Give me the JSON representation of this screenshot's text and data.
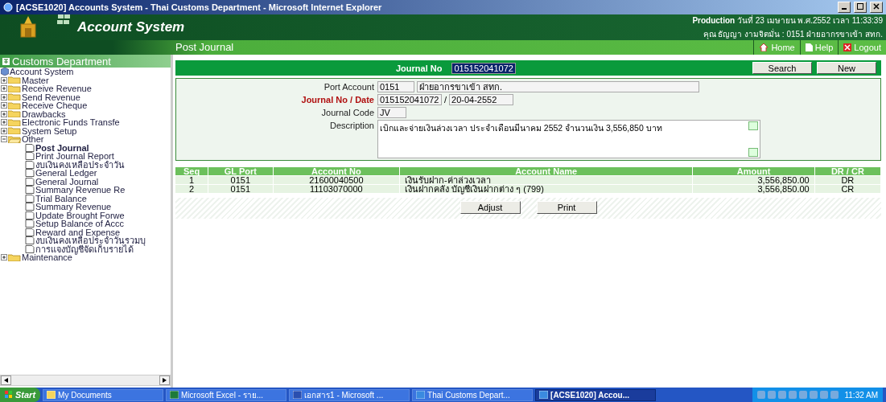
{
  "window": {
    "title": "[ACSE1020] Accounts System - Thai Customs Department - Microsoft Internet Explorer"
  },
  "header": {
    "app_name": "Account System",
    "environment": "Production",
    "datetime": "วันที่ 23 เมษายน พ.ศ.2552 เวลา 11:33:39",
    "user": "คุณ ธัญญา งามจิตมั่น : 0151 ฝ่ายอากรขาเข้า สทก.",
    "page_title": "Post Journal",
    "links": [
      {
        "kind": "home",
        "label": "Home"
      },
      {
        "kind": "help",
        "label": "Help"
      },
      {
        "kind": "logout",
        "label": "Logout"
      }
    ]
  },
  "sidebar": {
    "title": "Customs Department",
    "root": "Account System",
    "items": [
      {
        "label": "Master",
        "expanded": false
      },
      {
        "label": "Receive Revenue",
        "expanded": false
      },
      {
        "label": "Send Revenue",
        "expanded": false
      },
      {
        "label": "Receive Cheque",
        "expanded": false
      },
      {
        "label": "Drawbacks",
        "expanded": false
      },
      {
        "label": "Electronic Funds Transfe",
        "expanded": false
      },
      {
        "label": "System Setup",
        "expanded": false
      },
      {
        "label": "Other",
        "expanded": true,
        "children": [
          {
            "label": "Post Journal",
            "selected": true
          },
          {
            "label": "Print Journal Report",
            "selected": false
          },
          {
            "label": "งบเงินคงเหลือประจำวัน",
            "selected": false
          },
          {
            "label": "General Ledger",
            "selected": false
          },
          {
            "label": "General Journal",
            "selected": false
          },
          {
            "label": "Summary Revenue Re",
            "selected": false
          },
          {
            "label": "Trial Balance",
            "selected": false
          },
          {
            "label": "Summary Revenue",
            "selected": false
          },
          {
            "label": "Update Brought Forwe",
            "selected": false
          },
          {
            "label": "Setup Balance of Accc",
            "selected": false
          },
          {
            "label": "Reward and Expense",
            "selected": false
          },
          {
            "label": "งบเงินคงเหลือประจำวันรวมบุ",
            "selected": false
          },
          {
            "label": "การแจงบัญชีจัดเก็บรายได้",
            "selected": false
          }
        ]
      },
      {
        "label": "Maintenance",
        "expanded": false
      }
    ]
  },
  "search_bar": {
    "label": "Journal No",
    "value": "015152041072",
    "buttons": [
      "Search",
      "New"
    ]
  },
  "form": {
    "fields": [
      {
        "kind": "pair",
        "label": "Port Account",
        "required": false,
        "values": [
          "0151",
          "ฝ่ายอากรขาเข้า สทก."
        ]
      },
      {
        "kind": "date",
        "label": "Journal No / Date",
        "required": true,
        "values": [
          "015152041072",
          "20-04-2552"
        ],
        "separator": "/"
      },
      {
        "kind": "single",
        "label": "Journal Code",
        "required": false,
        "values": [
          "JV"
        ]
      },
      {
        "kind": "textarea",
        "label": "Description",
        "required": false,
        "values": [
          "เบิกและจ่ายเงินล่วงเวลา ประจำเดือนมีนาคม 2552 จำนวนเงิน 3,556,850 บาท"
        ]
      }
    ]
  },
  "table": {
    "columns": [
      "Seq",
      "GL Port",
      "Account No",
      "Account Name",
      "Amount",
      "DR / CR"
    ],
    "rows": [
      [
        "1",
        "0151",
        "21600040500",
        "เงินรับฝาก-ค่าล่วงเวลา",
        "3,556,850.00",
        "DR"
      ],
      [
        "2",
        "0151",
        "11103070000",
        "เงินฝากคลัง บัญชีเงินฝากต่าง ๆ (799)",
        "3,556,850.00",
        "CR"
      ]
    ]
  },
  "actions": [
    "Adjust",
    "Print"
  ],
  "taskbar": {
    "start": "Start",
    "items": [
      {
        "label": "My Documents",
        "kind": "folder",
        "selected": false
      },
      {
        "label": "Microsoft Excel - ราย...",
        "kind": "excel",
        "selected": false
      },
      {
        "label": "เอกสาร1 - Microsoft ...",
        "kind": "word",
        "selected": false
      },
      {
        "label": "Thai Customs Depart...",
        "kind": "ie",
        "selected": false
      },
      {
        "label": "[ACSE1020] Accou...",
        "kind": "ie",
        "selected": true
      }
    ],
    "clock": "11:32 AM"
  }
}
